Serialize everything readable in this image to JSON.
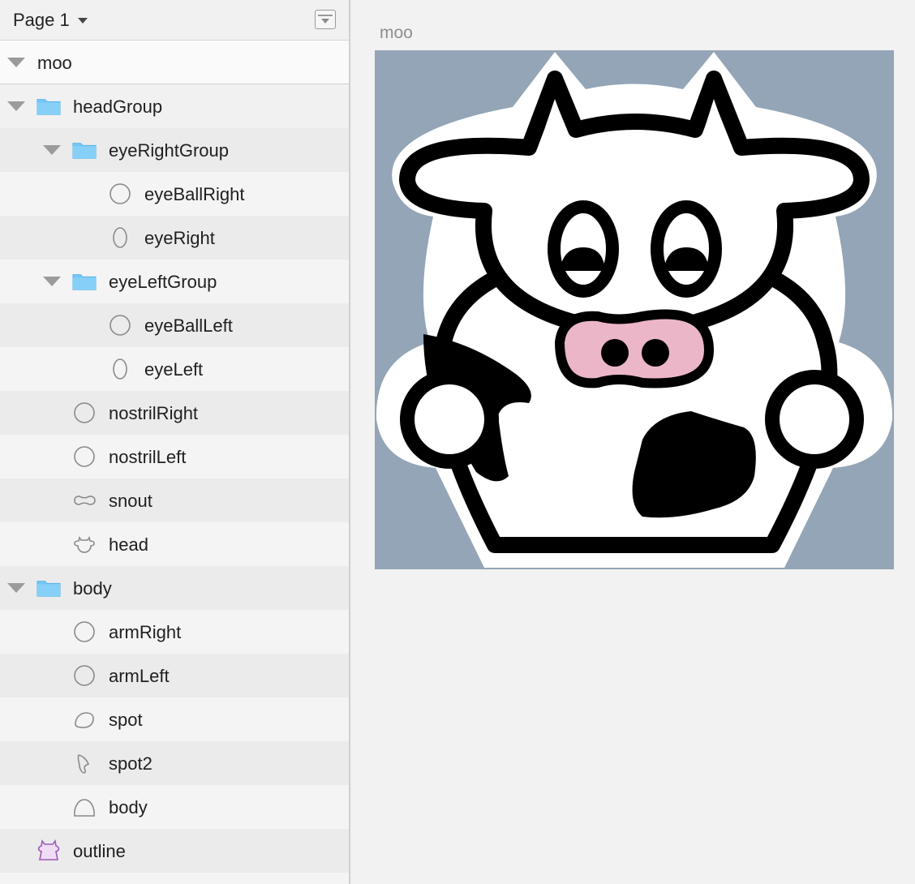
{
  "page": {
    "name": "Page 1"
  },
  "artboard": {
    "name": "moo",
    "background": "#93a5b6"
  },
  "layers": [
    {
      "name": "headGroup",
      "icon": "folder-icon"
    },
    {
      "name": "eyeRightGroup",
      "icon": "folder-icon"
    },
    {
      "name": "eyeBallRight",
      "icon": "oval-icon"
    },
    {
      "name": "eyeRight",
      "icon": "ellipse-icon"
    },
    {
      "name": "eyeLeftGroup",
      "icon": "folder-icon"
    },
    {
      "name": "eyeBallLeft",
      "icon": "oval-icon"
    },
    {
      "name": "eyeLeft",
      "icon": "ellipse-icon"
    },
    {
      "name": "nostrilRight",
      "icon": "oval-icon"
    },
    {
      "name": "nostrilLeft",
      "icon": "oval-icon"
    },
    {
      "name": "snout",
      "icon": "snout-shape-icon"
    },
    {
      "name": "head",
      "icon": "head-shape-icon"
    },
    {
      "name": "body",
      "icon": "folder-icon"
    },
    {
      "name": "armRight",
      "icon": "oval-icon"
    },
    {
      "name": "armLeft",
      "icon": "oval-icon"
    },
    {
      "name": "spot",
      "icon": "spot-shape-icon"
    },
    {
      "name": "spot2",
      "icon": "spot2-shape-icon"
    },
    {
      "name": "body",
      "icon": "body-shape-icon"
    },
    {
      "name": "outline",
      "icon": "outline-shape-icon"
    }
  ],
  "colors": {
    "snout": "#ebb7c8",
    "folder": "#74c6f5",
    "outline_icon": "#9b5bb5"
  }
}
